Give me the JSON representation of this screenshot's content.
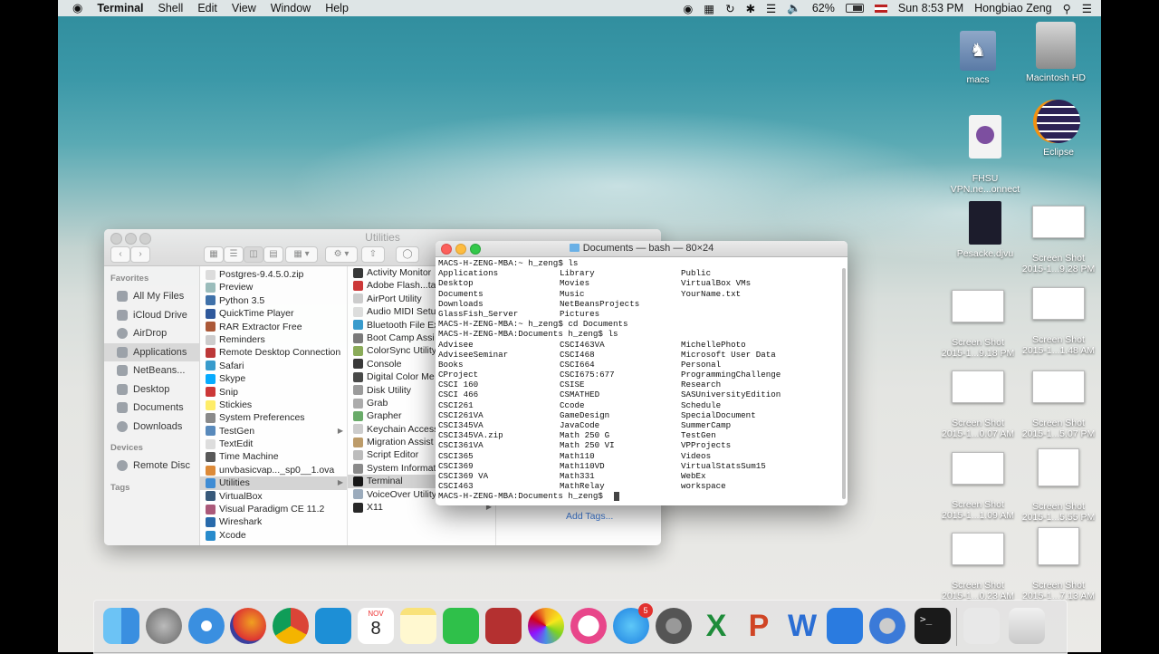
{
  "menubar": {
    "app": "Terminal",
    "items": [
      "Shell",
      "Edit",
      "View",
      "Window",
      "Help"
    ],
    "battery": "62%",
    "clock": "Sun 8:53 PM",
    "user": "Hongbiao Zeng"
  },
  "desktop_icons": [
    {
      "label": "macs",
      "icon": "people-folder-icon"
    },
    {
      "label": "Macintosh HD",
      "icon": "hard-drive-icon"
    },
    {
      "label": "FHSU\nVPN.ne...onnect",
      "icon": "vpn-icon"
    },
    {
      "label": "Eclipse",
      "icon": "eclipse-icon"
    },
    {
      "label": "Pesacke.djvu",
      "icon": "document-icon"
    },
    {
      "label": "Screen Shot\n2015-1...9.28 PM",
      "icon": "screenshot-icon"
    },
    {
      "label": "Screen Shot\n2015-1...9.18 PM",
      "icon": "screenshot-icon"
    },
    {
      "label": "Screen Shot\n2015-1...1.48 AM",
      "icon": "screenshot-icon"
    },
    {
      "label": "Screen Shot\n2015-1...0.07 AM",
      "icon": "screenshot-icon"
    },
    {
      "label": "Screen Shot\n2015-1...5.07 PM",
      "icon": "screenshot-icon"
    },
    {
      "label": "Screen Shot\n2015-1...1.09 AM",
      "icon": "screenshot-icon"
    },
    {
      "label": "Screen Shot\n2015-1...5.55 PM",
      "icon": "screenshot-icon"
    },
    {
      "label": "Screen Shot\n2015-1...0.23 AM",
      "icon": "screenshot-icon"
    },
    {
      "label": "Screen Shot\n2015-1...7.13 AM",
      "icon": "screenshot-icon"
    }
  ],
  "finder": {
    "title": "Utilities",
    "sidebar_headers": {
      "favorites": "Favorites",
      "devices": "Devices",
      "tags": "Tags"
    },
    "favorites": [
      "All My Files",
      "iCloud Drive",
      "AirDrop",
      "Applications",
      "NetBeans...",
      "Desktop",
      "Documents",
      "Downloads"
    ],
    "devices": [
      "Remote Disc"
    ],
    "applications": [
      "Postgres-9.4.5.0.zip",
      "Preview",
      "Python 3.5",
      "QuickTime Player",
      "RAR Extractor Free",
      "Reminders",
      "Remote Desktop Connection",
      "Safari",
      "Skype",
      "Snip",
      "Stickies",
      "System Preferences",
      "TestGen",
      "TextEdit",
      "Time Machine",
      "unvbasicvap..._sp0__1.ova",
      "Utilities",
      "VirtualBox",
      "Visual Paradigm CE 11.2",
      "Wireshark",
      "Xcode"
    ],
    "utilities": [
      "Activity Monitor",
      "Adobe Flash...ta",
      "AirPort Utility",
      "Audio MIDI Setup",
      "Bluetooth File Ex",
      "Boot Camp Assi",
      "ColorSync Utility",
      "Console",
      "Digital Color Me",
      "Disk Utility",
      "Grab",
      "Grapher",
      "Keychain Access",
      "Migration Assist",
      "Script Editor",
      "System Informat",
      "Terminal",
      "VoiceOver Utility",
      "X11"
    ],
    "preview_add_tags": "Add Tags..."
  },
  "terminal": {
    "title": "Documents — bash — 80×24",
    "lines": [
      [
        "MACS-H-ZENG-MBA:~ h_zeng$ ls",
        "",
        ""
      ],
      [
        "Applications",
        "Library",
        "Public"
      ],
      [
        "Desktop",
        "Movies",
        "VirtualBox VMs"
      ],
      [
        "Documents",
        "Music",
        "YourName.txt"
      ],
      [
        "Downloads",
        "NetBeansProjects",
        ""
      ],
      [
        "GlassFish_Server",
        "Pictures",
        ""
      ],
      [
        "MACS-H-ZENG-MBA:~ h_zeng$ cd Documents",
        "",
        ""
      ],
      [
        "MACS-H-ZENG-MBA:Documents h_zeng$ ls",
        "",
        ""
      ],
      [
        "Advisee",
        "CSCI463VA",
        "MichellePhoto"
      ],
      [
        "AdviseeSeminar",
        "CSCI468",
        "Microsoft User Data"
      ],
      [
        "Books",
        "CSCI664",
        "Personal"
      ],
      [
        "CProject",
        "CSCI675:677",
        "ProgrammingChallenge"
      ],
      [
        "CSCI 160",
        "CSISE",
        "Research"
      ],
      [
        "CSCI 466",
        "CSMATHED",
        "SASUniversityEdition"
      ],
      [
        "CSCI261",
        "Ccode",
        "Schedule"
      ],
      [
        "CSCI261VA",
        "GameDesign",
        "SpecialDocument"
      ],
      [
        "CSCI345VA",
        "JavaCode",
        "SummerCamp"
      ],
      [
        "CSCI345VA.zip",
        "Math 250 G",
        "TestGen"
      ],
      [
        "CSCI361VA",
        "Math 250 VI",
        "VPProjects"
      ],
      [
        "CSCI365",
        "Math110",
        "Videos"
      ],
      [
        "CSCI369",
        "Math110VD",
        "VirtualStatsSum15"
      ],
      [
        "CSCI369 VA",
        "Math331",
        "WebEx"
      ],
      [
        "CSCI463",
        "MathRelay",
        "workspace"
      ],
      [
        "MACS-H-ZENG-MBA:Documents h_zeng$ ",
        "",
        ""
      ]
    ]
  },
  "dock": {
    "apps": [
      "Finder",
      "Launchpad",
      "Safari",
      "Firefox",
      "Chrome",
      "Sourcetree",
      "Calendar",
      "Notes",
      "FaceTime",
      "Photo Booth",
      "Photos",
      "iTunes",
      "App Store",
      "System Preferences",
      "Excel",
      "PowerPoint",
      "Word",
      "Xcode",
      "QuickTime Player",
      "Terminal",
      "Window",
      "Trash"
    ],
    "calendar_month": "NOV",
    "calendar_day": "8",
    "appstore_badge": "5"
  }
}
